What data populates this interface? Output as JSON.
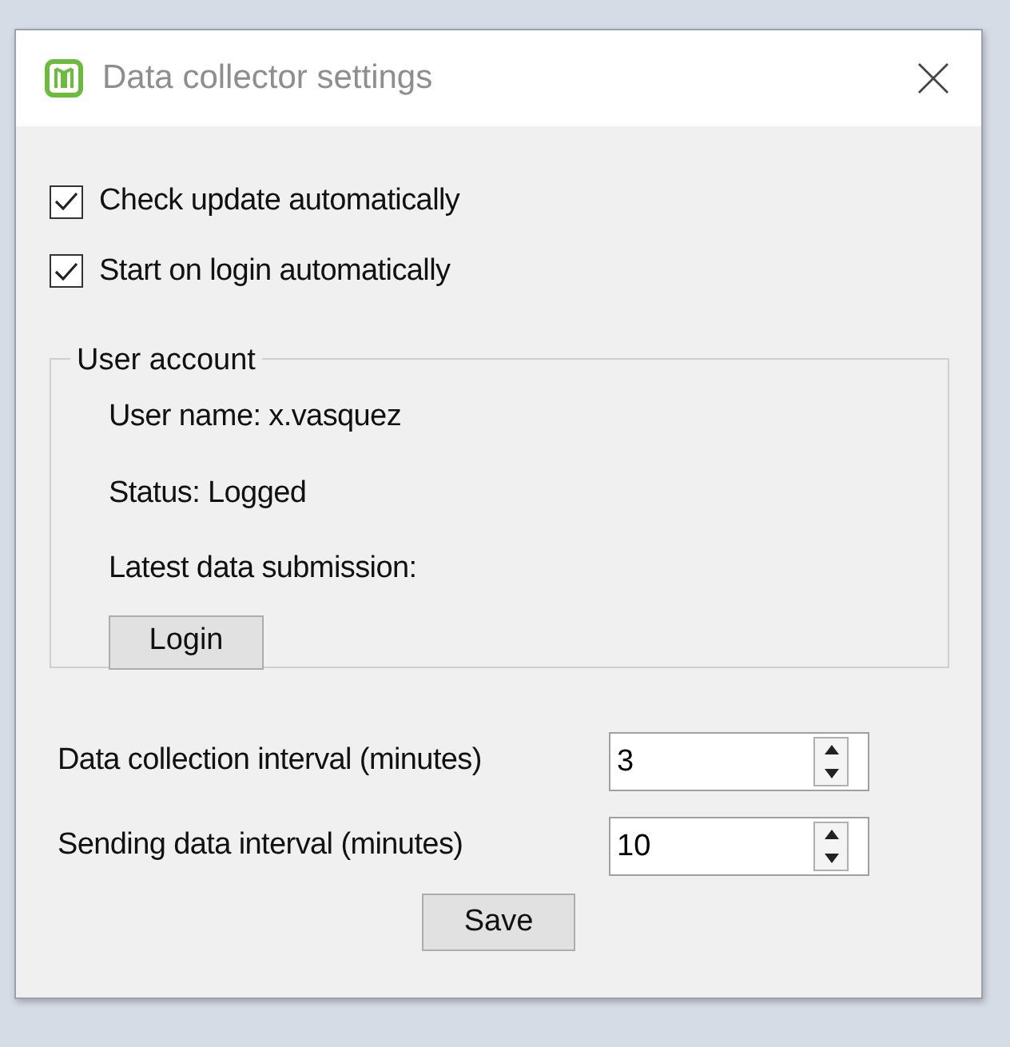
{
  "window": {
    "title": "Data collector settings"
  },
  "checkboxes": [
    {
      "label": "Check update automatically",
      "checked": true
    },
    {
      "label": "Start on login automatically",
      "checked": true
    }
  ],
  "user_account": {
    "legend": "User account",
    "lines": [
      "User name: x.vasquez",
      "Status: Logged",
      "Latest data submission:"
    ],
    "button": "Login"
  },
  "intervals": [
    {
      "label": "Data collection interval (minutes)",
      "value": "3"
    },
    {
      "label": "Sending data interval (minutes)",
      "value": "10"
    }
  ],
  "save_button": "Save"
}
